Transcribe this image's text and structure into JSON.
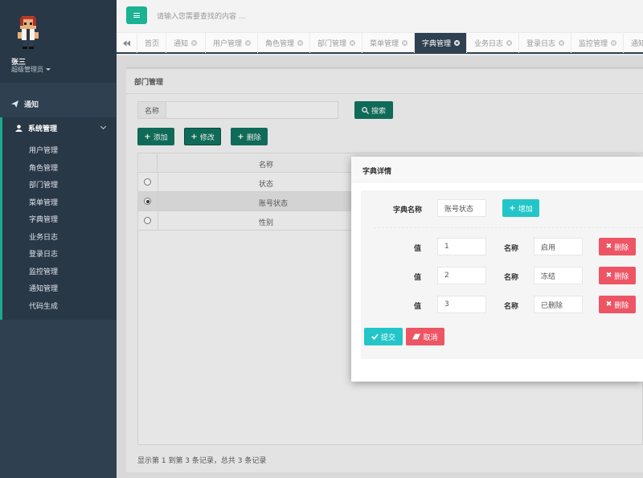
{
  "user": {
    "name": "张三",
    "role": "超级管理员"
  },
  "sidebar": {
    "notice": "通知",
    "system": "系统管理",
    "subitems": [
      "用户管理",
      "角色管理",
      "部门管理",
      "菜单管理",
      "字典管理",
      "业务日志",
      "登录日志",
      "监控管理",
      "通知管理",
      "代码生成"
    ]
  },
  "header": {
    "search_placeholder": "请输入您需要查找的内容 ..."
  },
  "tabs": [
    {
      "label": "首页",
      "closable": false
    },
    {
      "label": "通知",
      "closable": true
    },
    {
      "label": "用户管理",
      "closable": true
    },
    {
      "label": "角色管理",
      "closable": true
    },
    {
      "label": "部门管理",
      "closable": true
    },
    {
      "label": "菜单管理",
      "closable": true
    },
    {
      "label": "字典管理",
      "closable": true,
      "active": true
    },
    {
      "label": "业务日志",
      "closable": true
    },
    {
      "label": "登录日志",
      "closable": true
    },
    {
      "label": "监控管理",
      "closable": true
    },
    {
      "label": "通知",
      "closable": false
    }
  ],
  "panel": {
    "title": "部门管理",
    "search_label": "名称",
    "search_button": "搜索",
    "add_button": "添加",
    "edit_button": "修改",
    "delete_button": "删除",
    "table": {
      "column": "名称",
      "rows": [
        {
          "name": "状态",
          "selected": false
        },
        {
          "name": "账号状态",
          "selected": true
        },
        {
          "name": "性别",
          "selected": false
        }
      ]
    },
    "footer": "显示第 1 到第 3 条记录，总共 3 条记录"
  },
  "modal": {
    "title": "字典详情",
    "dict_name_label": "字典名称",
    "dict_name_value": "账号状态",
    "add_button": "增加",
    "value_label": "值",
    "name_label": "名称",
    "delete_button": "删除",
    "entries": [
      {
        "value": "1",
        "name": "启用"
      },
      {
        "value": "2",
        "name": "冻结"
      },
      {
        "value": "3",
        "name": "已删除"
      }
    ],
    "submit_button": "提交",
    "cancel_button": "取消"
  },
  "colors": {
    "sidebar": "#2f4050",
    "primary": "#1ab394",
    "info": "#23c6c8",
    "danger": "#ed5565"
  }
}
